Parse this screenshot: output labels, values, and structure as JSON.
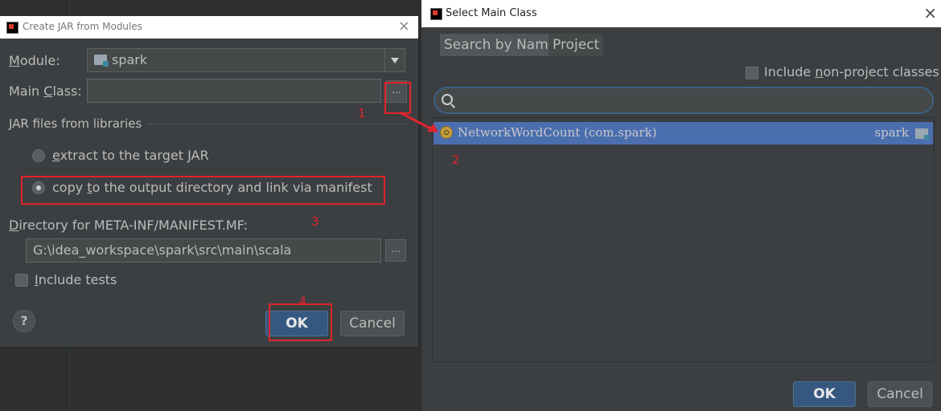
{
  "left_dialog": {
    "title": "Create JAR from Modules",
    "close": "×",
    "module_label_key": "M",
    "module_label_rest": "odule:",
    "module_value": "spark",
    "main_class_label_pre": "Main ",
    "main_class_label_key": "C",
    "main_class_label_post": "lass:",
    "main_class_value": "",
    "browse_label": "...",
    "jar_section_label": "JAR files from libraries",
    "radio_extract_key": "e",
    "radio_extract_rest": "xtract to the target JAR",
    "radio_copy_pre": "copy ",
    "radio_copy_key": "t",
    "radio_copy_rest": "o the output directory and link via manifest",
    "manifest_label_key": "D",
    "manifest_label_rest": "irectory for META-INF/MANIFEST.MF:",
    "manifest_value": "G:\\idea_workspace\\spark\\src\\main\\scala",
    "include_tests_key": "I",
    "include_tests_rest": "nclude tests",
    "help": "?",
    "ok": "OK",
    "cancel": "Cancel"
  },
  "right_dialog": {
    "title": "Select Main Class",
    "close": "×",
    "tabs": [
      {
        "label": "Search by Name"
      },
      {
        "label": "Project"
      }
    ],
    "include_nonproject_pre": "Include ",
    "include_nonproject_key": "n",
    "include_nonproject_rest": "on-project classes",
    "search_value": "",
    "results": [
      {
        "name": "NetworkWordCount (com.spark)",
        "module": "spark"
      }
    ],
    "ok": "OK",
    "cancel": "Cancel"
  },
  "annotations": {
    "step1": "1",
    "step2": "2",
    "step3": "3",
    "step4": "4",
    "color": "#e0242b"
  },
  "colors": {
    "dialog_bg": "#3c3f41",
    "selection": "#4b6eaf",
    "default_button": "#365880"
  }
}
